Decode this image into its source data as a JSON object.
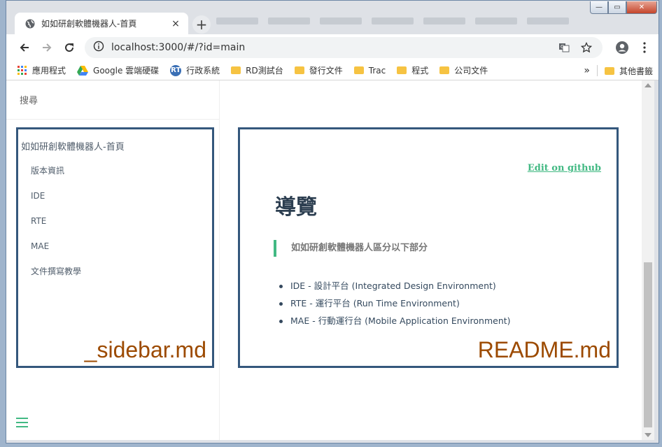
{
  "browser": {
    "tab_title": "如如研創軟體機器人-首頁",
    "tab_close": "×",
    "new_tab": "+",
    "url": "localhost:3000/#/?id=main",
    "window_buttons": {
      "minimize": "—",
      "maximize": "▭",
      "close": "✕"
    }
  },
  "bookmarks": {
    "items": [
      {
        "label": "應用程式",
        "icon": "apps-grid-icon"
      },
      {
        "label": "Google 雲端硬碟",
        "icon": "google-drive-icon"
      },
      {
        "label": "行政系統",
        "icon": "rt-icon",
        "badge": "RT"
      },
      {
        "label": "RD測試台",
        "icon": "folder-icon"
      },
      {
        "label": "發行文件",
        "icon": "folder-icon"
      },
      {
        "label": "Trac",
        "icon": "folder-icon"
      },
      {
        "label": "程式",
        "icon": "folder-icon"
      },
      {
        "label": "公司文件",
        "icon": "folder-icon"
      }
    ],
    "overflow": "»",
    "other": "其他書籤"
  },
  "sidebar": {
    "search_placeholder": "搜尋",
    "title": "如如研創軟體機器人-首頁",
    "items": [
      "版本資訊",
      "IDE",
      "RTE",
      "MAE",
      "文件撰寫教學"
    ],
    "file_label": "_sidebar.md"
  },
  "content": {
    "edit_link": "Edit on github",
    "heading": "導覽",
    "quote": "如如研創軟體機器人區分以下部分",
    "bullets": [
      "IDE - 設計平台 (Integrated Design Environment)",
      "RTE - 運行平台 (Run Time Environment)",
      "MAE - 行動運行台 (Mobile Application Environment)"
    ],
    "file_label": "README.md"
  },
  "colors": {
    "accent": "#42b983",
    "frame": "#34577c",
    "annotation": "#9c4a00"
  }
}
